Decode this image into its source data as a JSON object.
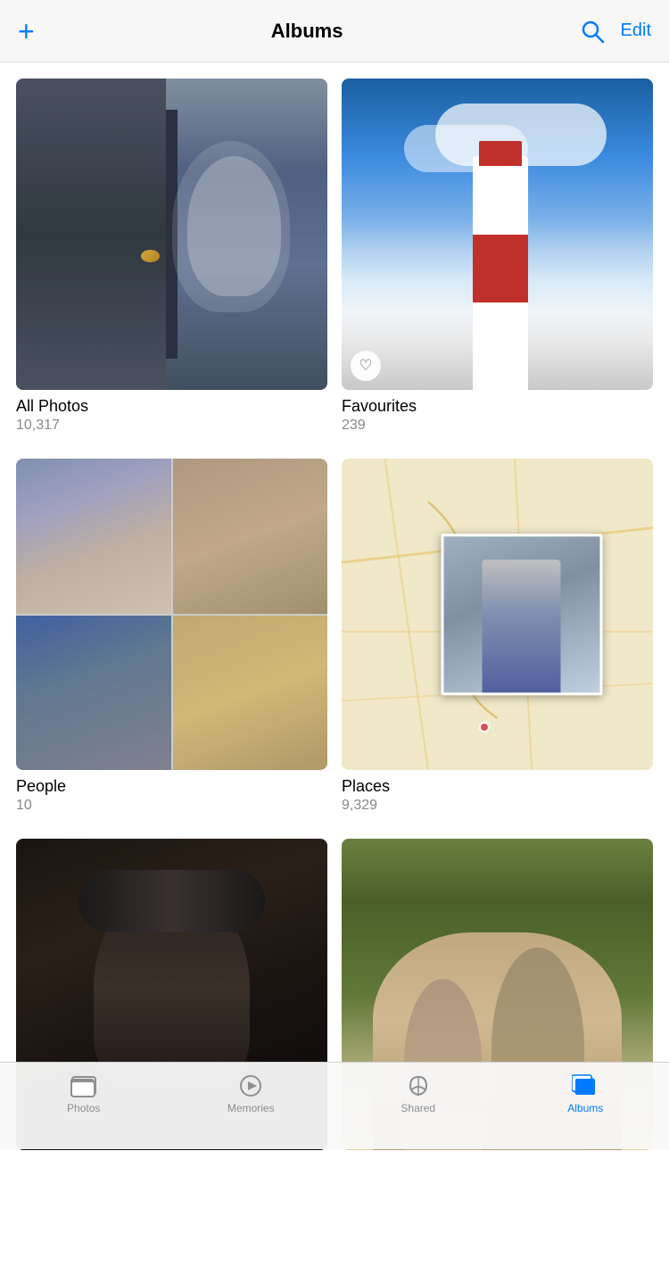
{
  "header": {
    "add_label": "+",
    "title": "Albums",
    "edit_label": "Edit"
  },
  "albums": [
    {
      "id": "all-photos",
      "name": "All Photos",
      "count": "10,317",
      "has_heart": false
    },
    {
      "id": "favourites",
      "name": "Favourites",
      "count": "239",
      "has_heart": true
    },
    {
      "id": "people",
      "name": "People",
      "count": "10",
      "has_heart": false
    },
    {
      "id": "places",
      "name": "Places",
      "count": "9,329",
      "has_heart": false
    },
    {
      "id": "album3",
      "name": "",
      "count": "",
      "has_heart": false
    },
    {
      "id": "album4",
      "name": "",
      "count": "",
      "has_heart": false
    }
  ],
  "tabs": [
    {
      "id": "photos",
      "label": "Photos",
      "active": false
    },
    {
      "id": "memories",
      "label": "Memories",
      "active": false
    },
    {
      "id": "shared",
      "label": "Shared",
      "active": false
    },
    {
      "id": "albums",
      "label": "Albums",
      "active": true
    }
  ]
}
